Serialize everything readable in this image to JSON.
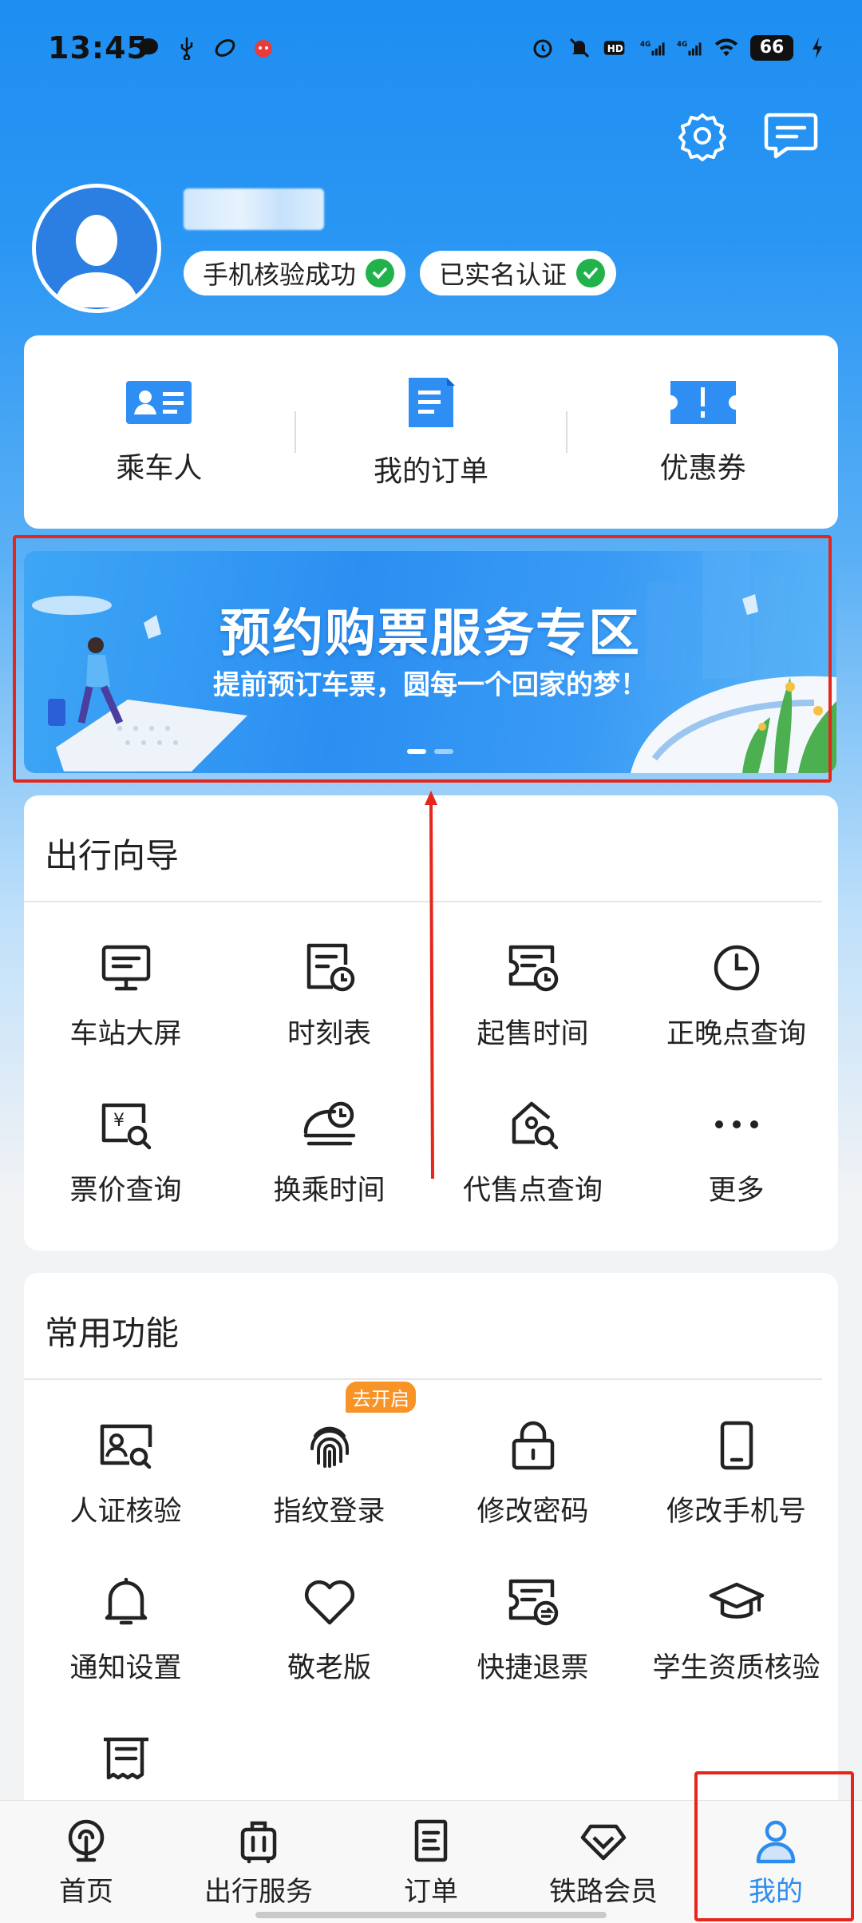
{
  "status_bar": {
    "time": "13:45",
    "battery": "66"
  },
  "profile": {
    "badges": [
      "手机核验成功",
      "已实名认证"
    ]
  },
  "quick_actions": [
    {
      "label": "乘车人",
      "icon": "passenger-card-icon"
    },
    {
      "label": "我的订单",
      "icon": "order-document-icon"
    },
    {
      "label": "优惠券",
      "icon": "coupon-icon"
    }
  ],
  "banner": {
    "title": "预约购票服务专区",
    "subtitle": "提前预订车票，圆每一个回家的梦！"
  },
  "travel_guide": {
    "title": "出行向导",
    "items": [
      {
        "label": "车站大屏",
        "icon": "station-screen-icon"
      },
      {
        "label": "时刻表",
        "icon": "timetable-icon"
      },
      {
        "label": "起售时间",
        "icon": "sale-time-icon"
      },
      {
        "label": "正晚点查询",
        "icon": "clock-icon"
      },
      {
        "label": "票价查询",
        "icon": "fare-search-icon"
      },
      {
        "label": "换乘时间",
        "icon": "transfer-time-icon"
      },
      {
        "label": "代售点查询",
        "icon": "agency-search-icon"
      },
      {
        "label": "更多",
        "icon": "more-icon"
      }
    ]
  },
  "common_functions": {
    "title": "常用功能",
    "items": [
      {
        "label": "人证核验",
        "icon": "id-verify-icon"
      },
      {
        "label": "指纹登录",
        "icon": "fingerprint-icon",
        "tag": "去开启"
      },
      {
        "label": "修改密码",
        "icon": "lock-icon"
      },
      {
        "label": "修改手机号",
        "icon": "phone-icon"
      },
      {
        "label": "通知设置",
        "icon": "bell-icon"
      },
      {
        "label": "敬老版",
        "icon": "heart-icon"
      },
      {
        "label": "快捷退票",
        "icon": "refund-ticket-icon"
      },
      {
        "label": "学生资质核验",
        "icon": "graduation-cap-icon"
      },
      {
        "label": "",
        "icon": "invoice-icon"
      }
    ]
  },
  "bottom_nav": [
    {
      "label": "首页",
      "icon": "home-train-icon"
    },
    {
      "label": "出行服务",
      "icon": "luggage-icon"
    },
    {
      "label": "订单",
      "icon": "order-icon"
    },
    {
      "label": "铁路会员",
      "icon": "diamond-icon"
    },
    {
      "label": "我的",
      "icon": "person-icon",
      "active": true
    }
  ],
  "colors": {
    "primary": "#2d8cf0",
    "header_blue": "#1e8ef2",
    "annotation_red": "#e5261c",
    "badge_check": "#21b24b",
    "tag_orange": "#f79327"
  }
}
